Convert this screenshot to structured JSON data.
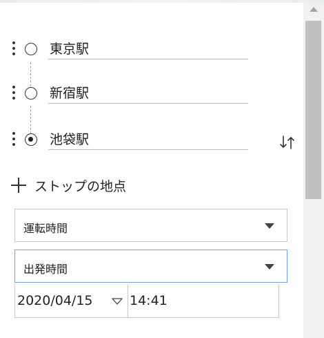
{
  "waypoints": [
    {
      "value": "東京駅",
      "role": "start"
    },
    {
      "value": "新宿駅",
      "role": "via"
    },
    {
      "value": "池袋駅",
      "role": "destination"
    }
  ],
  "add_stop": {
    "label": "ストップの地点",
    "icon": "plus-icon"
  },
  "swap": {
    "icon": "swap-vertical-icon",
    "glyph": "↓↑"
  },
  "travel_mode": {
    "selected": "運転時間"
  },
  "time_mode": {
    "selected": "出発時間"
  },
  "datetime": {
    "date": "2020/04/15",
    "time": "14:41"
  },
  "colors": {
    "focus_border": "#6fa2e6",
    "scroll_thumb": "#c1c1c1",
    "scroll_track": "#f1f1f1"
  }
}
